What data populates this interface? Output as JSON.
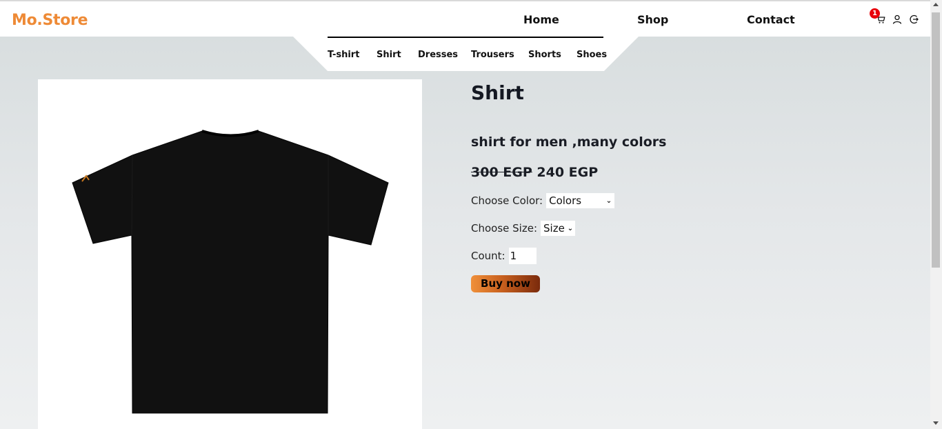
{
  "brand": {
    "logo": "Mo.Store",
    "color": "#ee8a36"
  },
  "main_nav": [
    {
      "label": "Home"
    },
    {
      "label": "Shop"
    },
    {
      "label": "Contact"
    }
  ],
  "header_icons": {
    "cart": {
      "icon": "cart-icon",
      "badge_count": "1"
    },
    "user": {
      "icon": "user-icon"
    },
    "logout": {
      "icon": "logout-icon"
    }
  },
  "categories": [
    {
      "label": "T-shirt"
    },
    {
      "label": "Shirt"
    },
    {
      "label": "Dresses"
    },
    {
      "label": "Trousers"
    },
    {
      "label": "Shorts"
    },
    {
      "label": "Shoes"
    }
  ],
  "product": {
    "title": "Shirt",
    "description": "shirt for men ,many colors",
    "old_price": "300 EGP",
    "new_price": "240 EGP",
    "color_label": "Choose Color:",
    "color_selected": "Colors",
    "size_label": "Choose Size:",
    "size_selected": "Size",
    "count_label": "Count:",
    "count_value": "1",
    "buy_label": "Buy now",
    "image": "black-tshirt-back"
  }
}
